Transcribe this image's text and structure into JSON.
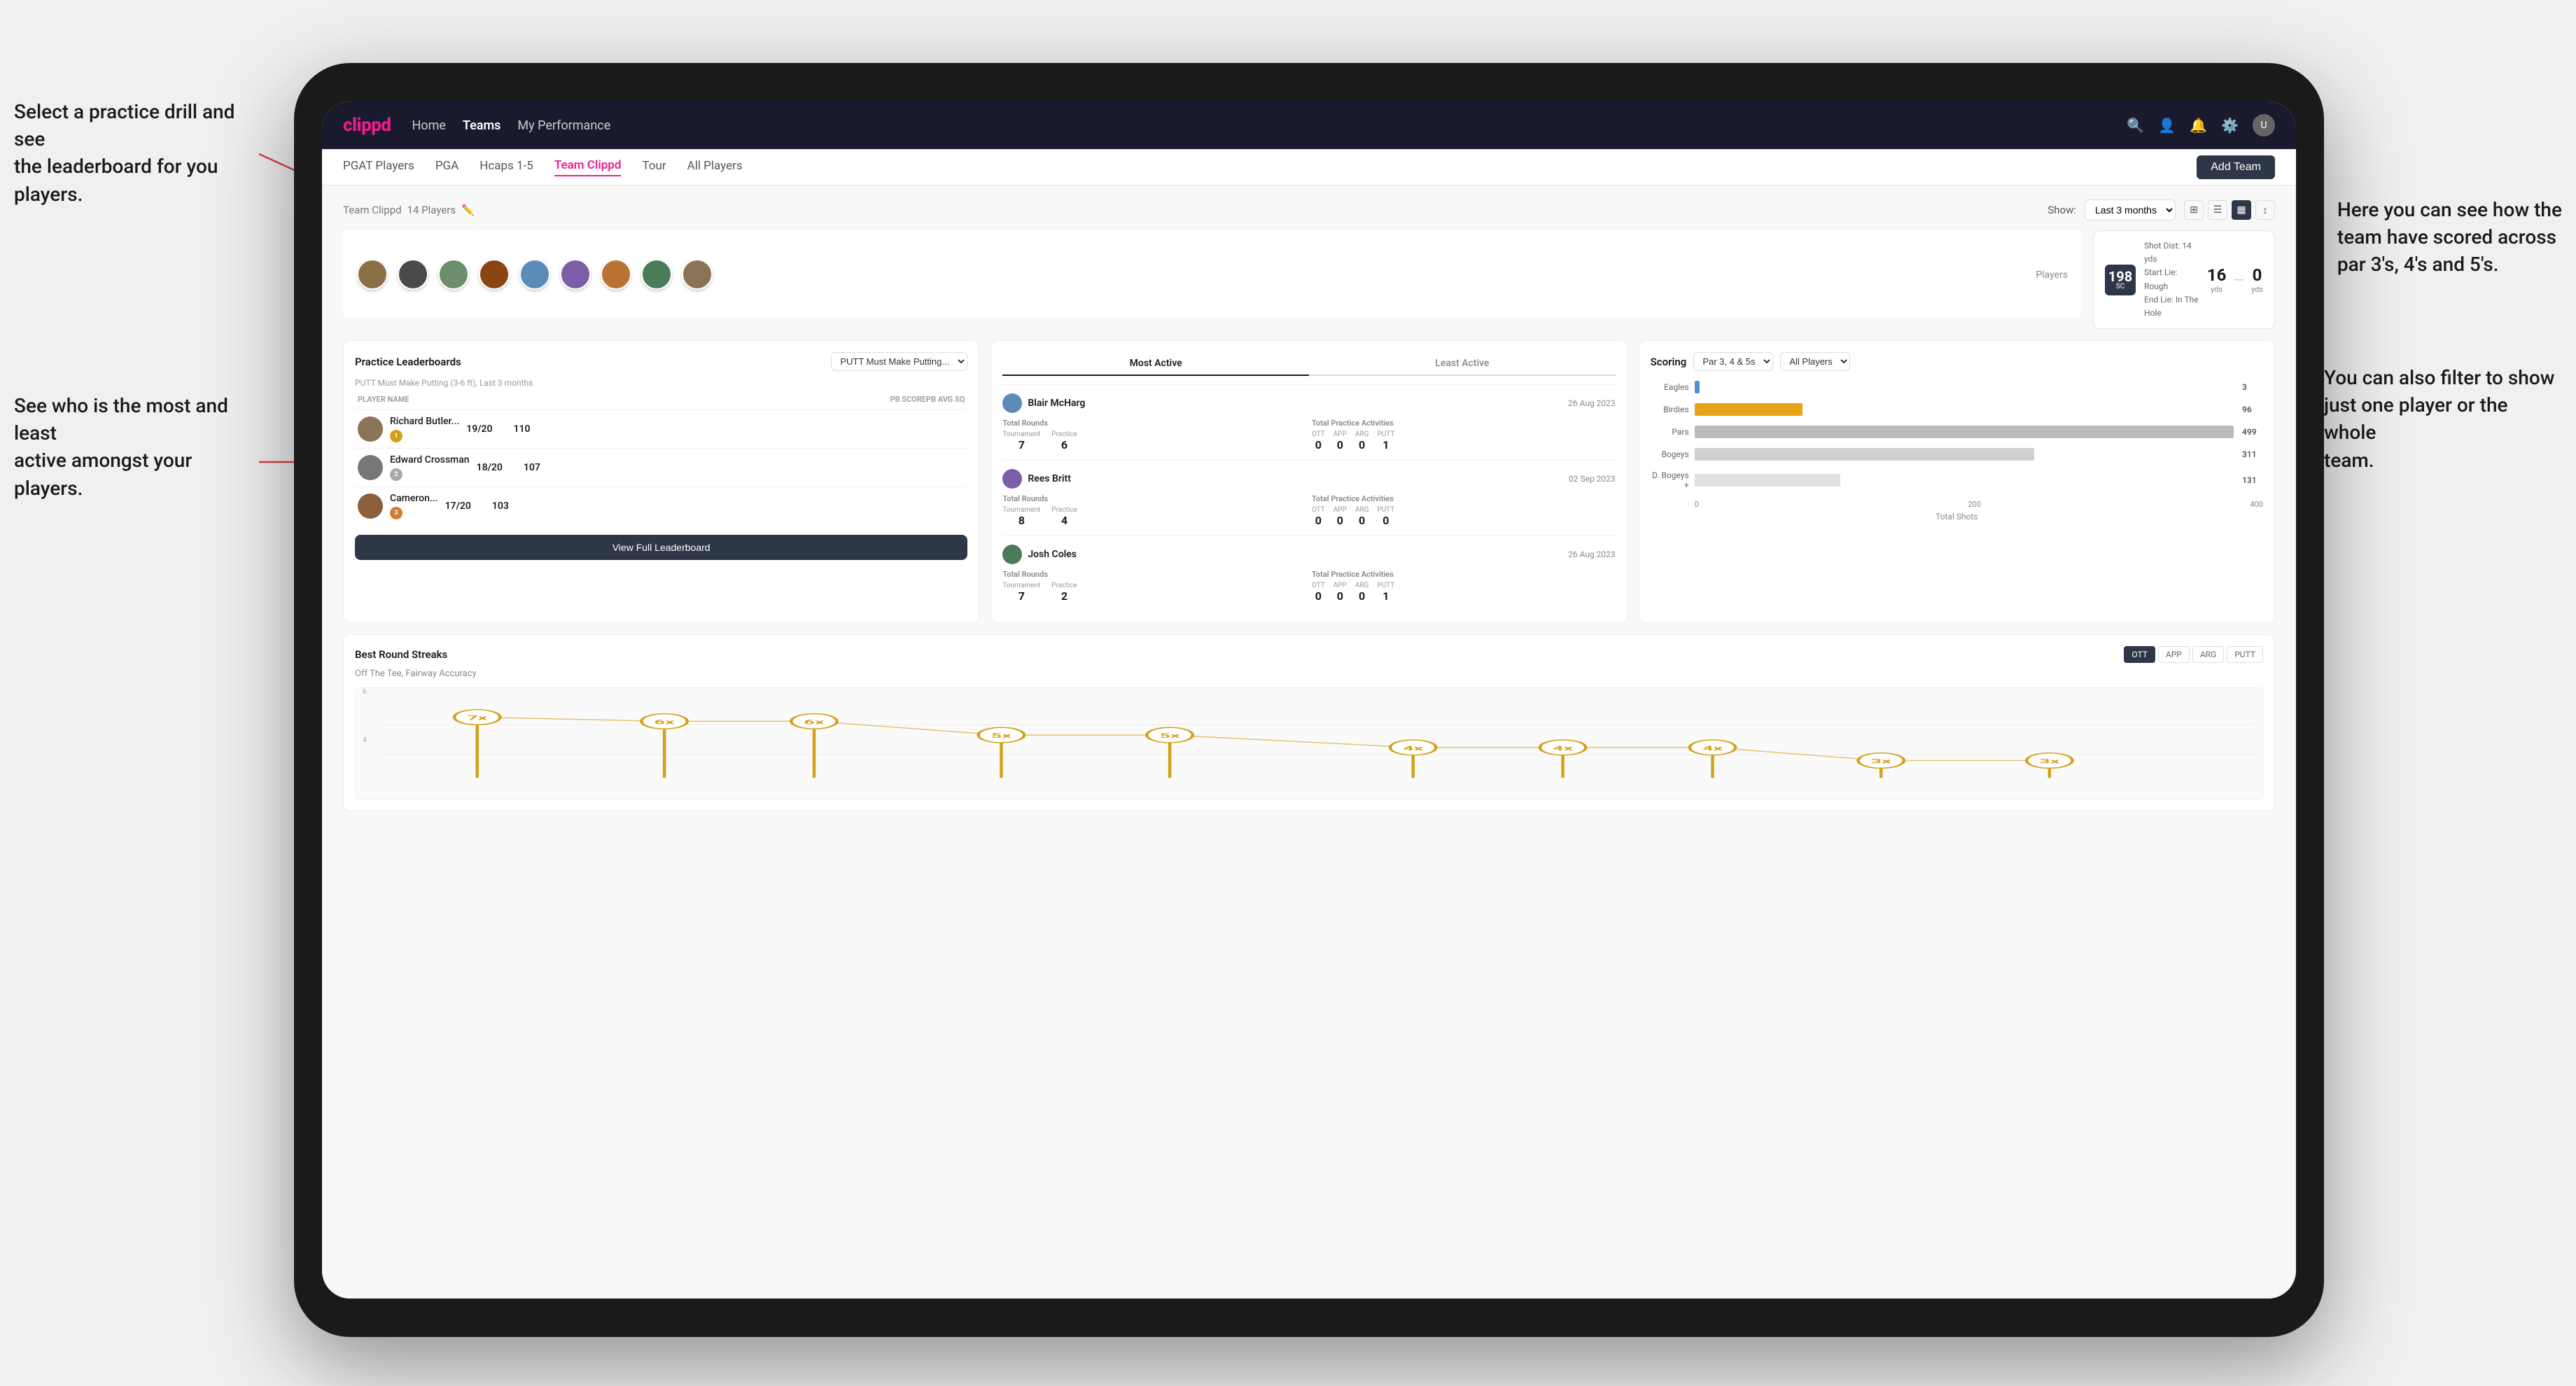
{
  "brand": "clippd",
  "navbar": {
    "links": [
      "Home",
      "Teams",
      "My Performance"
    ],
    "icons": [
      "search",
      "people",
      "bell",
      "settings",
      "user"
    ],
    "active_link": "Teams"
  },
  "sub_navbar": {
    "links": [
      "PGAT Players",
      "PGA",
      "Hcaps 1-5",
      "Team Clippd",
      "Tour",
      "All Players"
    ],
    "active_link": "Team Clippd",
    "add_team_label": "Add Team"
  },
  "team_section": {
    "title": "Team Clippd",
    "player_count": "14 Players",
    "show_label": "Show:",
    "show_period": "Last 3 months",
    "players_label": "Players",
    "shot_info": {
      "badge_num": "198",
      "badge_unit": "SC",
      "details": [
        "Shot Dist: 14 yds",
        "Start Lie: Rough",
        "End Lie: In The Hole"
      ],
      "yds1": "16",
      "yds1_label": "yds",
      "yds2": "0",
      "yds2_label": "yds"
    }
  },
  "practice_leaderboards": {
    "title": "Practice Leaderboards",
    "dropdown_label": "PUTT Must Make Putting...",
    "subtitle": "PUTT Must Make Putting (3-6 ft),",
    "subtitle_period": "Last 3 months",
    "columns": {
      "player_name": "PLAYER NAME",
      "pb_score": "PB SCORE",
      "avg_sq": "PB AVG SQ"
    },
    "players": [
      {
        "name": "Richard Butler...",
        "score": "19/20",
        "avg": "110",
        "medal": "gold",
        "rank": 1
      },
      {
        "name": "Edward Crossman",
        "score": "18/20",
        "avg": "107",
        "medal": "silver",
        "rank": 2
      },
      {
        "name": "Cameron...",
        "score": "17/20",
        "avg": "103",
        "medal": "bronze",
        "rank": 3
      }
    ],
    "view_full_label": "View Full Leaderboard"
  },
  "activity_section": {
    "tabs": [
      "Most Active",
      "Least Active"
    ],
    "active_tab": "Most Active",
    "players": [
      {
        "name": "Blair McHarg",
        "date": "26 Aug 2023",
        "total_rounds_label": "Total Rounds",
        "tournament": "7",
        "practice": "6",
        "total_practice_label": "Total Practice Activities",
        "ott": "0",
        "app": "0",
        "arg": "0",
        "putt": "1"
      },
      {
        "name": "Rees Britt",
        "date": "02 Sep 2023",
        "total_rounds_label": "Total Rounds",
        "tournament": "8",
        "practice": "4",
        "total_practice_label": "Total Practice Activities",
        "ott": "0",
        "app": "0",
        "arg": "0",
        "putt": "0"
      },
      {
        "name": "Josh Coles",
        "date": "26 Aug 2023",
        "total_rounds_label": "Total Rounds",
        "tournament": "7",
        "practice": "2",
        "total_practice_label": "Total Practice Activities",
        "ott": "0",
        "app": "0",
        "arg": "0",
        "putt": "1"
      }
    ]
  },
  "scoring_section": {
    "title": "Scoring",
    "filter1": "Par 3, 4 & 5s",
    "filter2": "All Players",
    "bars": [
      {
        "label": "Eagles",
        "value": 3,
        "max": 500,
        "color": "#4a90d9"
      },
      {
        "label": "Birdies",
        "value": 96,
        "max": 500,
        "color": "#e8a317"
      },
      {
        "label": "Pars",
        "value": 499,
        "max": 500,
        "color": "#bbb"
      },
      {
        "label": "Bogeys",
        "value": 311,
        "max": 500,
        "color": "#d0d0d0"
      },
      {
        "label": "D. Bogeys +",
        "value": 131,
        "max": 500,
        "color": "#e8e8e8"
      }
    ],
    "x_labels": [
      "0",
      "200",
      "400"
    ],
    "total_shots_label": "Total Shots"
  },
  "best_round_streaks": {
    "title": "Best Round Streaks",
    "subtitle": "Off The Tee, Fairway Accuracy",
    "tabs": [
      "OTT",
      "APP",
      "ARG",
      "PUTT"
    ],
    "active_tab": "OTT",
    "points": [
      {
        "x": 5,
        "y": 25,
        "label": "7x"
      },
      {
        "x": 15,
        "y": 30,
        "label": "6x"
      },
      {
        "x": 23,
        "y": 30,
        "label": "6x"
      },
      {
        "x": 33,
        "y": 45,
        "label": "5x"
      },
      {
        "x": 42,
        "y": 45,
        "label": "5x"
      },
      {
        "x": 55,
        "y": 60,
        "label": "4x"
      },
      {
        "x": 63,
        "y": 60,
        "label": "4x"
      },
      {
        "x": 71,
        "y": 60,
        "label": "4x"
      },
      {
        "x": 80,
        "y": 75,
        "label": "3x"
      },
      {
        "x": 89,
        "y": 75,
        "label": "3x"
      }
    ],
    "y_labels": [
      "6",
      "4",
      ""
    ]
  },
  "annotations": {
    "left1": "Select a practice drill and see\nthe leaderboard for you players.",
    "left2": "See who is the most and least\nactive amongst your players.",
    "right1": "Here you can see how the\nteam have scored across\npar 3's, 4's and 5's.",
    "right2": "You can also filter to show\njust one player or the whole\nteam."
  }
}
